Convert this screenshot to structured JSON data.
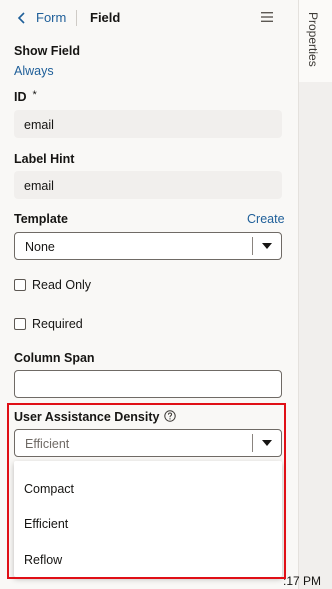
{
  "header": {
    "back_label": "Form",
    "title": "Field"
  },
  "side_tab": {
    "label": "Properties"
  },
  "fields": {
    "show_field": {
      "label": "Show Field",
      "value": "Always"
    },
    "id": {
      "label": "ID",
      "required_mark": "*",
      "value": "email"
    },
    "label_hint": {
      "label": "Label Hint",
      "value": "email"
    },
    "template": {
      "label": "Template",
      "create_label": "Create",
      "value": "None"
    },
    "read_only": {
      "label": "Read Only"
    },
    "required": {
      "label": "Required"
    },
    "column_span": {
      "label": "Column Span",
      "value": ""
    },
    "user_assistance_density": {
      "label": "User Assistance Density",
      "value": "Efficient",
      "options": [
        "Compact",
        "Efficient",
        "Reflow"
      ]
    }
  },
  "status": {
    "clock": ":17 PM"
  },
  "colors": {
    "link": "#1f5f99",
    "highlight": "#e00f16",
    "panel_bg": "#f9f8f6"
  }
}
